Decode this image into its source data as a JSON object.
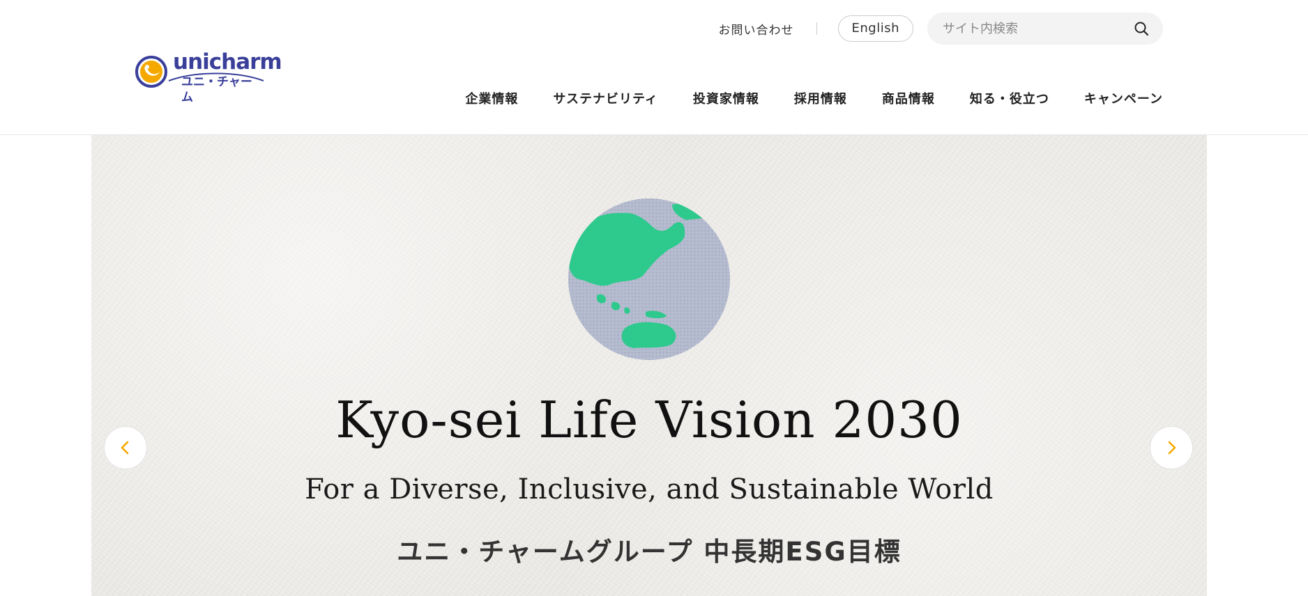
{
  "header": {
    "logo": {
      "wordmark": "unicharm",
      "kana": "ユニ・チャーム",
      "brand_color": "#3a3f9a",
      "mark_color": "#f5a800"
    },
    "utility": {
      "contact_label": "お問い合わせ",
      "english_label": "English",
      "search": {
        "placeholder": "サイト内検索",
        "icon": "search-icon"
      }
    },
    "nav": {
      "items": [
        {
          "label": "企業情報"
        },
        {
          "label": "サステナビリティ"
        },
        {
          "label": "投資家情報"
        },
        {
          "label": "採用情報"
        },
        {
          "label": "商品情報"
        },
        {
          "label": "知る・役立つ"
        },
        {
          "label": "キャンペーン"
        }
      ]
    }
  },
  "hero": {
    "title": "Kyo-sei Life Vision 2030",
    "subtitle": "For a Diverse, Inclusive, and Sustainable World",
    "caption": "ユニ・チャームグループ 中長期ESG目標",
    "globe": {
      "icon": "globe-illustration",
      "land_color": "#2ec98c",
      "ocean_color": "#b6bcd0"
    },
    "slider": {
      "prev_icon": "chevron-left-icon",
      "next_icon": "chevron-right-icon",
      "arrow_color": "#f5a800"
    }
  }
}
